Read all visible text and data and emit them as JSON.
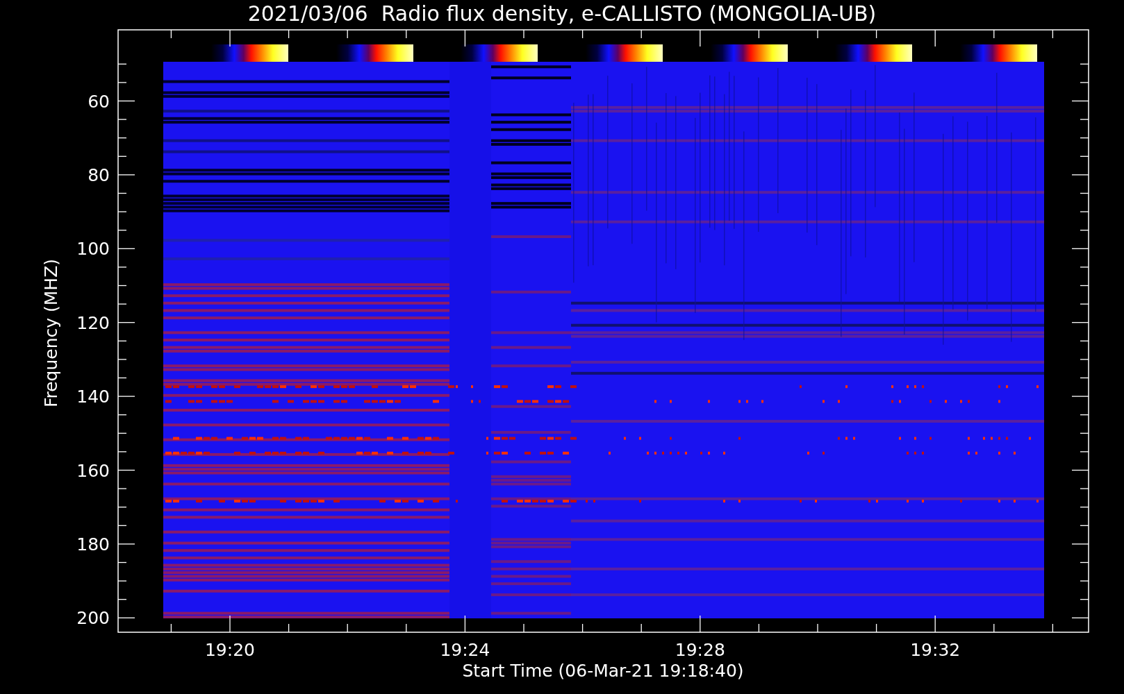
{
  "plot": {
    "title": "2021/03/06  Radio flux density, e-CALLISTO (MONGOLIA-UB)",
    "y_axis": {
      "label": "Frequency (MHZ)",
      "ticks": [
        "60",
        "80",
        "100",
        "120",
        "140",
        "160",
        "180",
        "200"
      ]
    },
    "x_axis": {
      "label": "Start Time (06-Mar-21 19:18:40)",
      "ticks": [
        "19:20",
        "19:24",
        "19:28",
        "19:32"
      ]
    }
  }
}
